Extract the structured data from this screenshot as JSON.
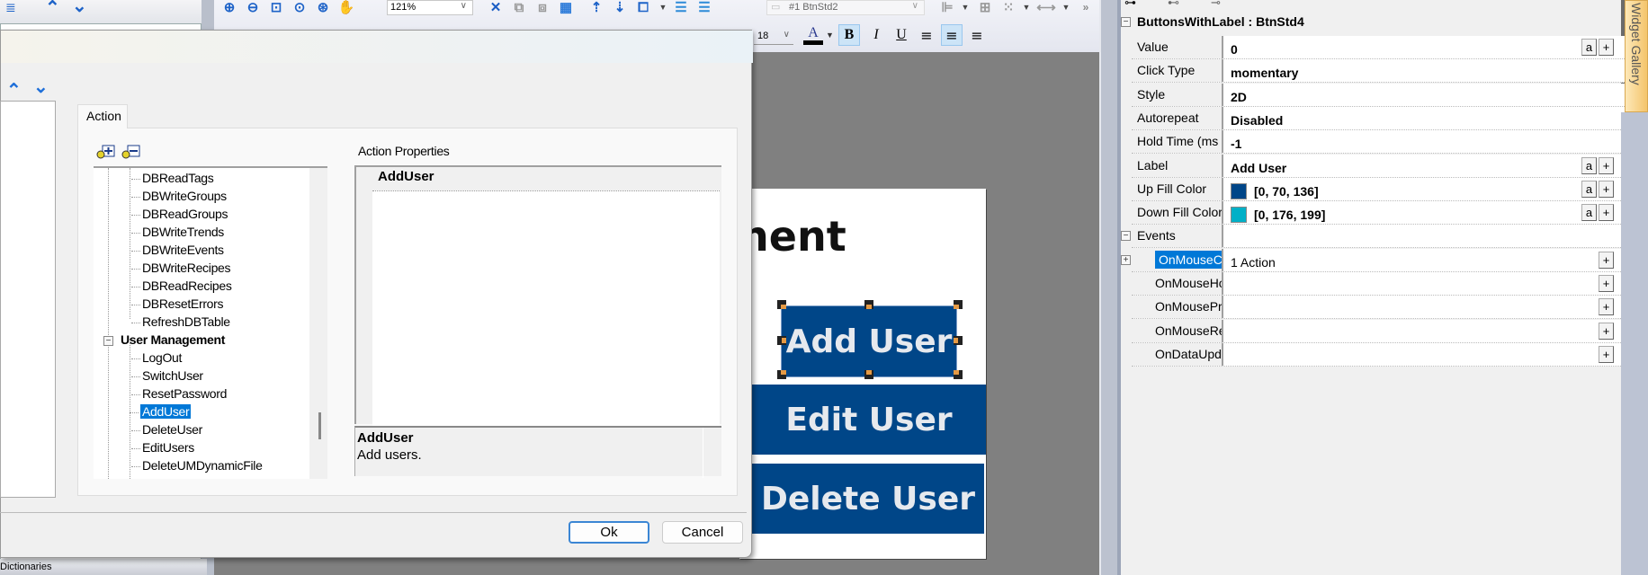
{
  "toolbar": {
    "zoom_level": "121%",
    "style_selector": "#1 BtnStd2",
    "font_size": "18",
    "buttons": [
      "zoom-in",
      "zoom-out",
      "zoom-page",
      "zoom-fit",
      "zoom-select",
      "pan",
      "delete",
      "group",
      "ungroup",
      "grid",
      "bring-forward",
      "send-backward",
      "arrange",
      "layer-up",
      "layer-down",
      "align",
      "center",
      "distribute",
      "space",
      "more"
    ],
    "format_buttons": {
      "font_color": "A",
      "bold": "B",
      "italic": "I",
      "underline": "U"
    }
  },
  "left_panel": {
    "bottom_tab": "Dictionaries"
  },
  "canvas": {
    "title_fragment": "nent",
    "buttons": [
      {
        "label": "Add User",
        "selected": true
      },
      {
        "label": "Edit User",
        "selected": false
      },
      {
        "label": "Delete User",
        "selected": false
      }
    ]
  },
  "dialog": {
    "tab_label": "Action",
    "tree": {
      "items": [
        {
          "label": "DBReadTags",
          "type": "leaf"
        },
        {
          "label": "DBWriteGroups",
          "type": "leaf"
        },
        {
          "label": "DBReadGroups",
          "type": "leaf"
        },
        {
          "label": "DBWriteTrends",
          "type": "leaf"
        },
        {
          "label": "DBWriteEvents",
          "type": "leaf"
        },
        {
          "label": "DBWriteRecipes",
          "type": "leaf"
        },
        {
          "label": "DBReadRecipes",
          "type": "leaf"
        },
        {
          "label": "DBResetErrors",
          "type": "leaf"
        },
        {
          "label": "RefreshDBTable",
          "type": "leaf"
        },
        {
          "label": "User Management",
          "type": "group"
        },
        {
          "label": "LogOut",
          "type": "leaf"
        },
        {
          "label": "SwitchUser",
          "type": "leaf"
        },
        {
          "label": "ResetPassword",
          "type": "leaf"
        },
        {
          "label": "AddUser",
          "type": "leaf",
          "selected": true
        },
        {
          "label": "DeleteUser",
          "type": "leaf"
        },
        {
          "label": "EditUsers",
          "type": "leaf"
        },
        {
          "label": "DeleteUMDynamicFile",
          "type": "leaf"
        }
      ]
    },
    "action_properties": {
      "label": "Action Properties",
      "header": "AddUser",
      "desc_title": "AddUser",
      "desc_text": "Add users."
    },
    "ok_label": "Ok",
    "cancel_label": "Cancel"
  },
  "properties": {
    "header": "ButtonsWithLabel : BtnStd4",
    "rows": [
      {
        "name": "Value",
        "value": "0",
        "buttons": [
          "a",
          "+"
        ]
      },
      {
        "name": "Click Type",
        "value": "momentary"
      },
      {
        "name": "Style",
        "value": "2D"
      },
      {
        "name": "Autorepeat",
        "value": "Disabled"
      },
      {
        "name": "Hold Time (ms",
        "value": "-1"
      },
      {
        "name": "Label",
        "value": "Add User",
        "buttons": [
          "a",
          "+"
        ]
      },
      {
        "name": "Up Fill Color",
        "value": "[0, 70, 136]",
        "swatch": "#004688",
        "buttons": [
          "a",
          "+"
        ]
      },
      {
        "name": "Down Fill Color",
        "value": "[0, 176, 199]",
        "swatch": "#00b0c7",
        "buttons": [
          "a",
          "+"
        ]
      }
    ],
    "events_label": "Events",
    "events": [
      {
        "name": "OnMouseClick",
        "value": "1 Action",
        "selected": true
      },
      {
        "name": "OnMouseHold",
        "value": ""
      },
      {
        "name": "OnMousePress",
        "value": ""
      },
      {
        "name": "OnMouseRelease",
        "value": ""
      },
      {
        "name": "OnDataUpdate",
        "value": ""
      }
    ]
  },
  "widget_gallery_label": "Widget Gallery",
  "colors": {
    "button_fill": "#004688",
    "selection": "#0078d7",
    "handle_accent": "#e59a45"
  }
}
